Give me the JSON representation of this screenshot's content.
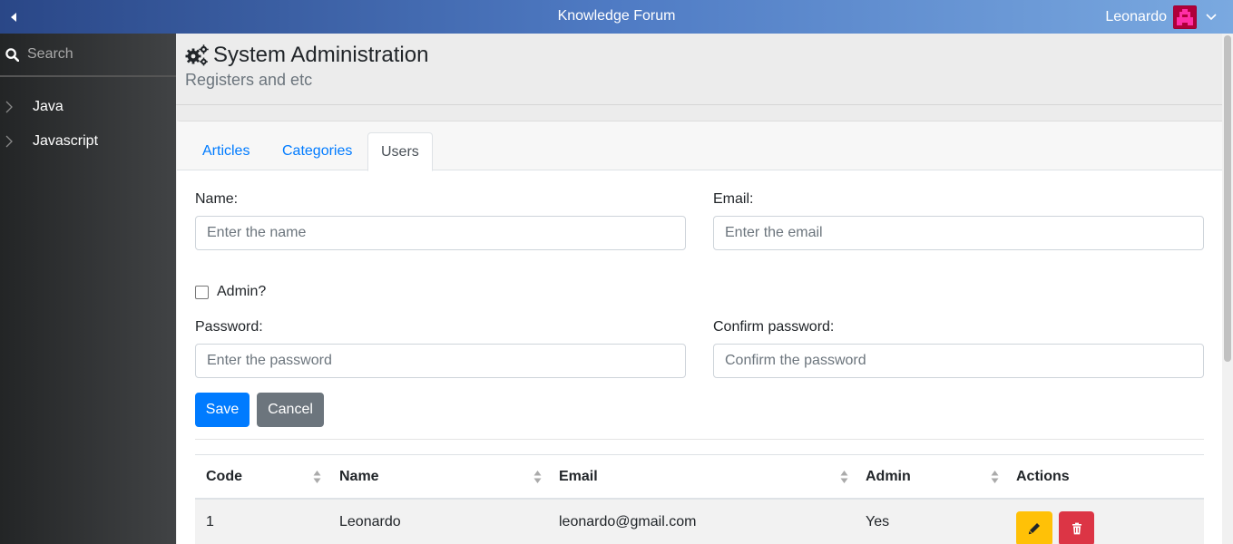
{
  "header": {
    "app_title": "Knowledge Forum",
    "user_name": "Leonardo",
    "gradient": [
      "#2a4787",
      "#7aa9e0"
    ]
  },
  "sidebar": {
    "search_placeholder": "Search",
    "items": [
      {
        "label": "Java",
        "icon": "chevron-right-icon"
      },
      {
        "label": "Javascript",
        "icon": "chevron-right-icon"
      }
    ]
  },
  "page": {
    "title": "System Administration",
    "subtitle": "Registers and etc",
    "title_icon": "cogs-icon"
  },
  "tabs": [
    {
      "label": "Articles",
      "active": false
    },
    {
      "label": "Categories",
      "active": false
    },
    {
      "label": "Users",
      "active": true
    }
  ],
  "form": {
    "name_label": "Name:",
    "name_placeholder": "Enter the name",
    "email_label": "Email:",
    "email_placeholder": "Enter the email",
    "admin_label": "Admin?",
    "admin_checked": false,
    "password_label": "Password:",
    "password_placeholder": "Enter the password",
    "confirm_label": "Confirm password:",
    "confirm_placeholder": "Confirm the password",
    "save_label": "Save",
    "cancel_label": "Cancel"
  },
  "table": {
    "headers": [
      "Code",
      "Name",
      "Email",
      "Admin",
      "Actions"
    ],
    "rows": [
      {
        "code": "1",
        "name": "Leonardo",
        "email": "leonardo@gmail.com",
        "admin": "Yes"
      }
    ]
  },
  "colors": {
    "primary": "#007bff",
    "secondary": "#6c757d",
    "warning": "#ffc107",
    "danger": "#dc3545"
  }
}
